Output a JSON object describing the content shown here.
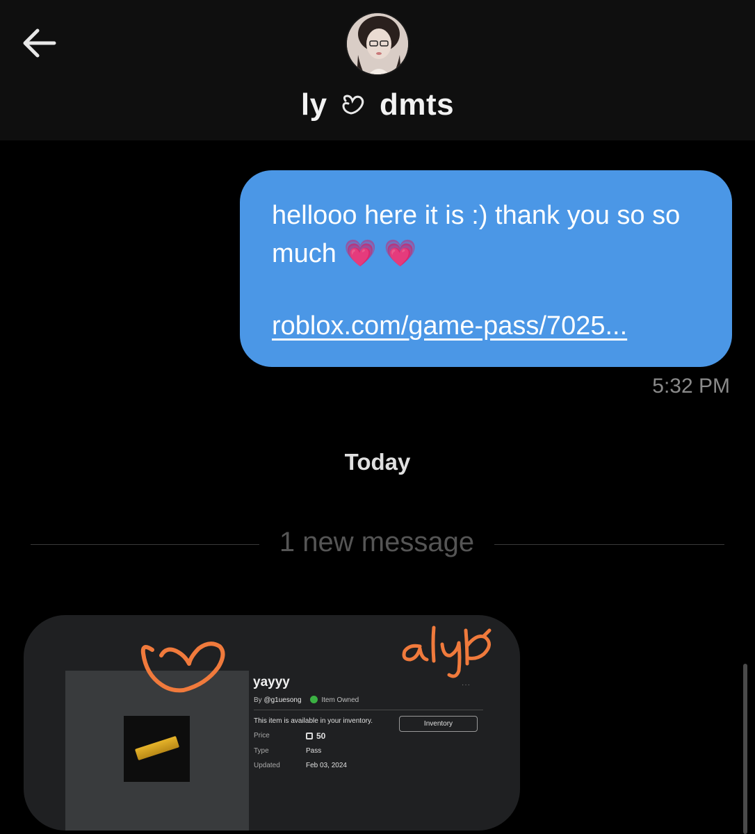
{
  "header": {
    "title_left": "ly",
    "title_right": "dmts",
    "back_icon": "arrow-left-icon",
    "avatar_icon": "profile-avatar"
  },
  "messages": {
    "outgoing_text": "hellooo here it is :) thank you so so much 💗 💗",
    "outgoing_link": "roblox.com/game-pass/7025...",
    "timestamp": "5:32 PM"
  },
  "date_label": "Today",
  "new_message_label": "1 new message",
  "image_message": {
    "item_name": "yayyy",
    "by_label": "By",
    "creator": "@g1uesong",
    "owned_label": "Item Owned",
    "availability": "This item is available in your inventory.",
    "inventory_button": "Inventory",
    "price_label": "Price",
    "price_value": "50",
    "type_label": "Type",
    "type_value": "Pass",
    "updated_label": "Updated",
    "updated_value": "Feb 03, 2024",
    "scribble_text": "alyb",
    "scribble_color": "#f07a3c"
  },
  "colors": {
    "bubble": "#4b97e6",
    "background": "#000000",
    "header": "#0f0f0f"
  }
}
